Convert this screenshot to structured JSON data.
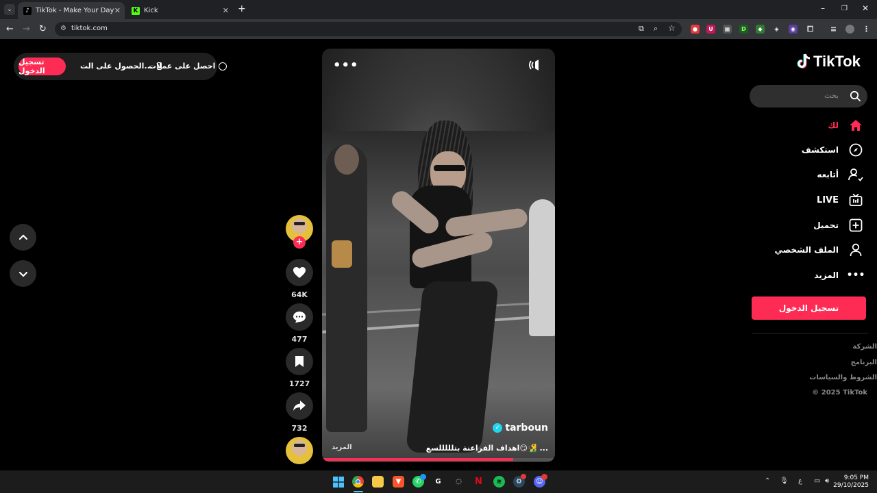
{
  "browser": {
    "tabs": [
      {
        "title": "TikTok - Make Your Day",
        "active": true,
        "icon": "tiktok-favicon"
      },
      {
        "title": "Kick",
        "active": false,
        "icon": "kick-favicon"
      }
    ],
    "url": "tikotok.com",
    "url_display": "tiktok.com"
  },
  "top_bar": {
    "login_label": "تسجيل الدخول",
    "get_app_label": "الحصول على الت...",
    "get_coins_label": "احصل على عملات"
  },
  "video": {
    "author": "tarboun",
    "caption": "اهداف الفراعنة بتلللللسع😏🧏‍♂️ ...",
    "more_label": "المزيد",
    "progress": 0.82
  },
  "actions": {
    "likes": "64K",
    "comments": "477",
    "saves": "1727",
    "shares": "732"
  },
  "sidebar": {
    "logo_text": "TikTok",
    "search_placeholder": "بحث",
    "nav": [
      {
        "label": "لك",
        "icon": "home-icon",
        "active": true
      },
      {
        "label": "استكشف",
        "icon": "compass-icon"
      },
      {
        "label": "أتابعه",
        "icon": "following-icon"
      },
      {
        "label": "LIVE",
        "icon": "live-icon"
      },
      {
        "label": "تحميل",
        "icon": "upload-icon"
      },
      {
        "label": "الملف الشخصي",
        "icon": "profile-icon"
      },
      {
        "label": "المزيد",
        "icon": "more-icon"
      }
    ],
    "login_button": "تسجيل الدخول",
    "footer": [
      "الشركة",
      "البرنامج",
      "الشروط والسياسات",
      "© 2025 TikTok"
    ]
  },
  "taskbar": {
    "time": "9:05 PM",
    "date": "29/10/2025",
    "lang": "ع"
  },
  "colors": {
    "accent": "#fe2c55",
    "verified": "#20d5ec",
    "background": "#000000"
  }
}
